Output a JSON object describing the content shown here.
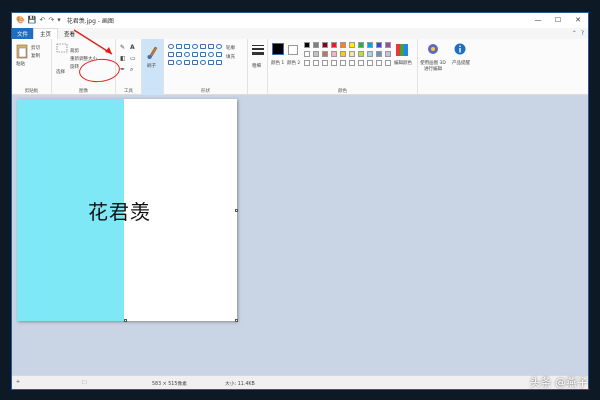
{
  "window": {
    "title": "花君羡.jpg - 画图",
    "quick_access": [
      "save-icon",
      "undo-icon",
      "redo-icon",
      "dropdown-icon"
    ],
    "controls": [
      "minimize-icon",
      "maximize-icon",
      "close-icon"
    ]
  },
  "tabs": {
    "file": "文件",
    "home": "主页",
    "view": "查看"
  },
  "ribbon": {
    "clipboard": {
      "label": "剪贴板",
      "paste": "粘贴",
      "cut": "剪切",
      "copy": "复制"
    },
    "image": {
      "label": "图像",
      "select": "选择",
      "crop": "裁剪",
      "resize": "重新调整大小",
      "rotate": "旋转"
    },
    "tools": {
      "label": "工具"
    },
    "brushes": {
      "label": "刷子"
    },
    "shapes": {
      "label": "形状",
      "outline": "轮廓",
      "fill": "填充"
    },
    "size": {
      "label": "粗细"
    },
    "colors": {
      "label": "颜色",
      "color1": "颜色 1",
      "color2": "颜色 2",
      "edit": "编辑颜色",
      "palette": [
        "#000000",
        "#7f7f7f",
        "#880015",
        "#ed1c24",
        "#ff7f27",
        "#fff200",
        "#22b14c",
        "#00a2e8",
        "#3f48cc",
        "#a349a4",
        "#ffffff",
        "#c3c3c3",
        "#b97a57",
        "#ffaec9",
        "#ffc90e",
        "#efe4b0",
        "#b5e61d",
        "#99d9ea",
        "#7092be",
        "#c8bfe7",
        "#ffffff",
        "#ffffff",
        "#ffffff",
        "#ffffff",
        "#ffffff",
        "#ffffff",
        "#ffffff",
        "#ffffff",
        "#ffffff",
        "#ffffff"
      ]
    },
    "paint3d": {
      "label": "使用画图 3D 进行编辑"
    },
    "alert": {
      "label": "产品提醒"
    }
  },
  "canvas": {
    "text": "花君羡",
    "left_color": "#7fe8f7",
    "right_color": "#ffffff"
  },
  "status": {
    "dimensions": "583 × 515像素",
    "file_size": "大小: 11.4KB"
  },
  "watermark": "头条 @燕子"
}
